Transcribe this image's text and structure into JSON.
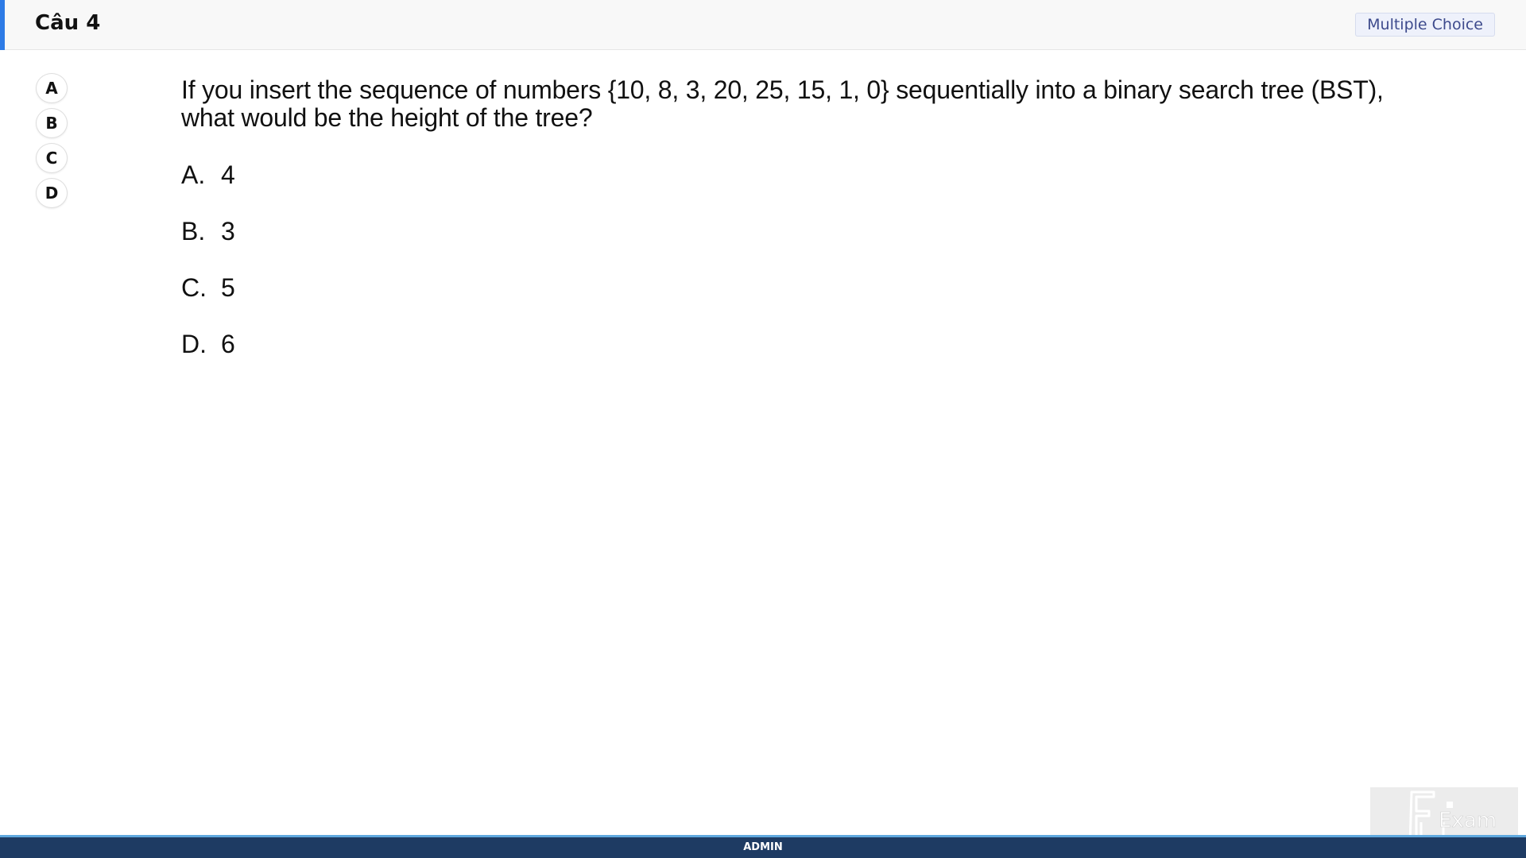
{
  "header": {
    "question_title": "Câu 4",
    "question_type": "Multiple Choice",
    "accent_color": "#2d7be6"
  },
  "answer_nav": [
    "A",
    "B",
    "C",
    "D"
  ],
  "question": {
    "line1": "If you insert the sequence of numbers {10, 8, 3, 20, 25, 15, 1, 0} sequentially into a binary search tree (BST),",
    "line2": "what would be the height of the tree?"
  },
  "options": [
    {
      "letter": "A.",
      "text": "4"
    },
    {
      "letter": "B.",
      "text": "3"
    },
    {
      "letter": "C.",
      "text": "5"
    },
    {
      "letter": "D.",
      "text": "6"
    }
  ],
  "watermark": {
    "text": "Exam"
  },
  "footer": {
    "label": "ADMIN",
    "color": "#1e3b63"
  }
}
